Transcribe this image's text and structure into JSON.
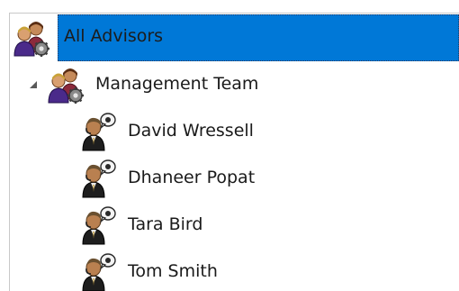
{
  "tree": {
    "root": {
      "label": "All Advisors",
      "icon": "group-advisors-icon",
      "selected": true
    },
    "team": {
      "label": "Management Team",
      "icon": "group-advisors-icon",
      "expanded": true,
      "members": [
        {
          "label": "David Wressell",
          "icon": "advisor-icon"
        },
        {
          "label": "Dhaneer Popat",
          "icon": "advisor-icon"
        },
        {
          "label": "Tara Bird",
          "icon": "advisor-icon"
        },
        {
          "label": "Tom Smith",
          "icon": "advisor-icon"
        }
      ]
    }
  },
  "colors": {
    "selection": "#0078d7",
    "text": "#1a1a1a",
    "border": "#c8c8c8"
  }
}
